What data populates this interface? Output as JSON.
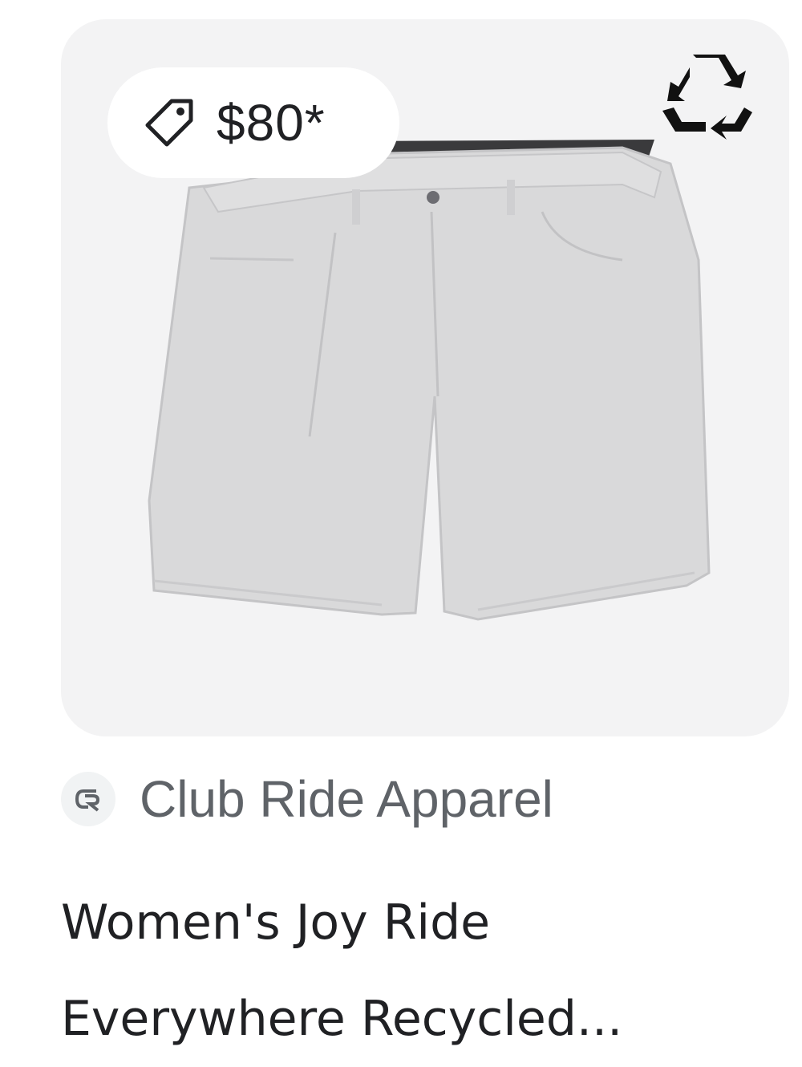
{
  "product": {
    "price": "$80*",
    "merchant": "Club Ride Apparel",
    "title_line_1": "Women's Joy Ride",
    "title_line_2": "Everywhere Recycled...",
    "image_subject": "gray shorts",
    "badges": {
      "price_icon": "tag-icon",
      "sustainability_icon": "recycle-icon",
      "merchant_logo_icon": "club-ride-logo-icon"
    }
  },
  "colors": {
    "image_background": "#f3f3f4",
    "price_pill": "#ffffff",
    "merchant_text": "#5f6368",
    "title_text": "#202124",
    "shorts": "#d9d9da"
  }
}
